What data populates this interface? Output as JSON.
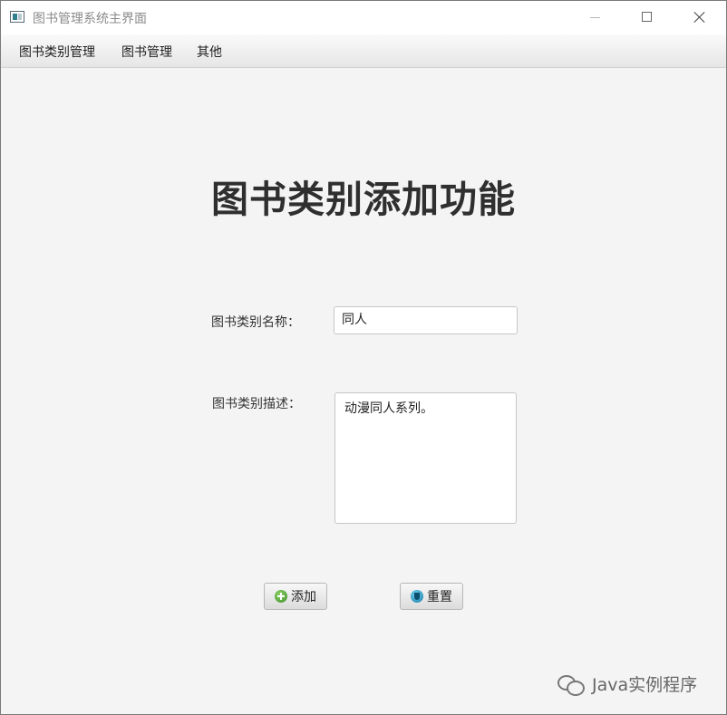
{
  "window": {
    "title": "图书管理系统主界面"
  },
  "menu": {
    "items": [
      "图书类别管理",
      "图书管理",
      "其他"
    ]
  },
  "page": {
    "title": "图书类别添加功能"
  },
  "form": {
    "name_label": "图书类别名称：",
    "name_value": "同人",
    "desc_label": "图书类别描述：",
    "desc_value": "动漫同人系列。"
  },
  "buttons": {
    "add_label": "添加",
    "reset_label": "重置"
  },
  "watermark": {
    "text": "Java实例程序"
  },
  "icons": {
    "app": "window-app-icon",
    "add": "green-plus-circle-icon",
    "reset": "blue-shield-icon",
    "watermark": "wechat-icon"
  },
  "colors": {
    "add_icon": "#3a8d25",
    "reset_icon": "#1779a8",
    "title_text": "#2f2f2f"
  }
}
